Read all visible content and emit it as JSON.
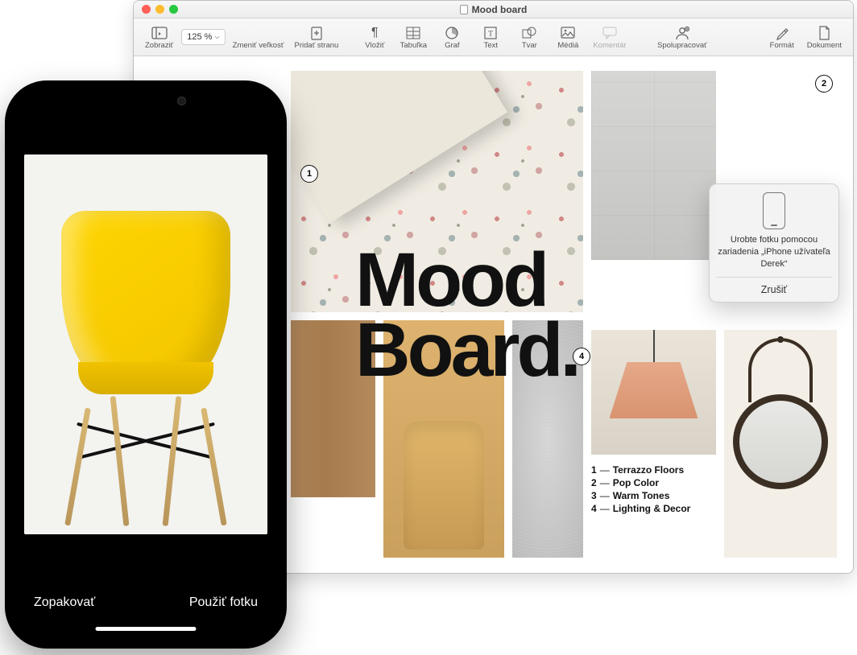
{
  "window": {
    "title": "Mood board"
  },
  "toolbar": {
    "zoom": "125 %",
    "buttons": {
      "view": "Zobraziť",
      "resize": "Zmeniť veľkosť",
      "addpage": "Pridať stranu",
      "insert": "Vložiť",
      "table": "Tabuľka",
      "chart": "Graf",
      "text": "Text",
      "shape": "Tvar",
      "media": "Médiá",
      "comment": "Komentár",
      "collab": "Spolupracovať",
      "format": "Formát",
      "document": "Dokument"
    }
  },
  "document": {
    "headline_line1": "Mood",
    "headline_line2": "Board.",
    "markers": {
      "m1": "1",
      "m2": "2",
      "m4": "4"
    },
    "legend": [
      {
        "num": "1",
        "label": "Terrazzo Floors"
      },
      {
        "num": "2",
        "label": "Pop Color"
      },
      {
        "num": "3",
        "label": "Warm Tones"
      },
      {
        "num": "4",
        "label": "Lighting & Decor"
      }
    ]
  },
  "popup": {
    "message": "Urobte fotku pomocou zariadenia „iPhone užívateľa Derek“",
    "cancel": "Zrušiť"
  },
  "iphone": {
    "retake": "Zopakovať",
    "use": "Použiť fotku"
  }
}
